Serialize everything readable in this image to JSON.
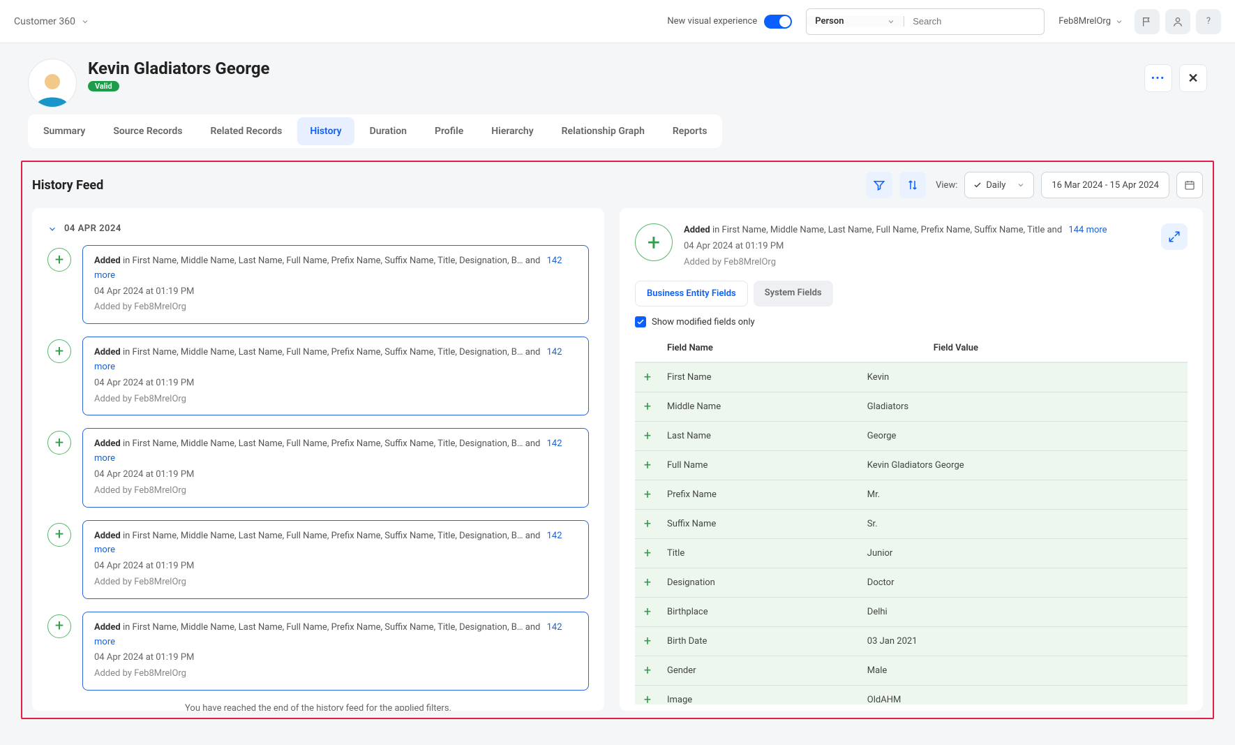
{
  "topbar": {
    "app_name": "Customer 360",
    "new_visual_label": "New visual experience",
    "entity": "Person",
    "search_placeholder": "Search",
    "org": "Feb8MrelOrg"
  },
  "record": {
    "name": "Kevin Gladiators George",
    "status": "Valid"
  },
  "tabs": [
    "Summary",
    "Source Records",
    "Related Records",
    "History",
    "Duration",
    "Profile",
    "Hierarchy",
    "Relationship Graph",
    "Reports"
  ],
  "active_tab": "History",
  "history": {
    "title": "History Feed",
    "view_label": "View:",
    "view_value": "Daily",
    "date_range": "16 Mar 2024 - 15 Apr 2024",
    "date_group": "04 APR 2024",
    "end_note": "You have reached the end of the history feed for the applied filters.",
    "feed_item": {
      "action": "Added",
      "in": "in",
      "fields": "First Name, Middle Name, Last Name, Full Name, Prefix Name, Suffix Name, Title, Designation, B…",
      "and": "and",
      "more": "142 more",
      "timestamp": "04 Apr 2024 at 01:19 PM",
      "by_prefix": "Added by",
      "by": "Feb8MrelOrg"
    }
  },
  "detail": {
    "action": "Added",
    "in": "in",
    "fields": "First Name, Middle Name, Last Name, Full Name, Prefix Name, Suffix Name, Title",
    "and": "and",
    "more": "144 more",
    "timestamp": "04 Apr 2024 at 01:19 PM",
    "by_prefix": "Added by",
    "by": "Feb8MrelOrg",
    "subtabs": {
      "be": "Business Entity Fields",
      "sys": "System Fields"
    },
    "show_modified": "Show modified fields only",
    "col_name": "Field Name",
    "col_value": "Field Value",
    "rows": [
      {
        "name": "First Name",
        "value": "Kevin"
      },
      {
        "name": "Middle Name",
        "value": "Gladiators"
      },
      {
        "name": "Last Name",
        "value": "George"
      },
      {
        "name": "Full Name",
        "value": "Kevin Gladiators George"
      },
      {
        "name": "Prefix Name",
        "value": "Mr."
      },
      {
        "name": "Suffix Name",
        "value": "Sr."
      },
      {
        "name": "Title",
        "value": "Junior"
      },
      {
        "name": "Designation",
        "value": "Doctor"
      },
      {
        "name": "Birthplace",
        "value": "Delhi"
      },
      {
        "name": "Birth Date",
        "value": "03 Jan 2021"
      },
      {
        "name": "Gender",
        "value": "Male"
      },
      {
        "name": "Image",
        "value": "OldAHM"
      }
    ]
  }
}
